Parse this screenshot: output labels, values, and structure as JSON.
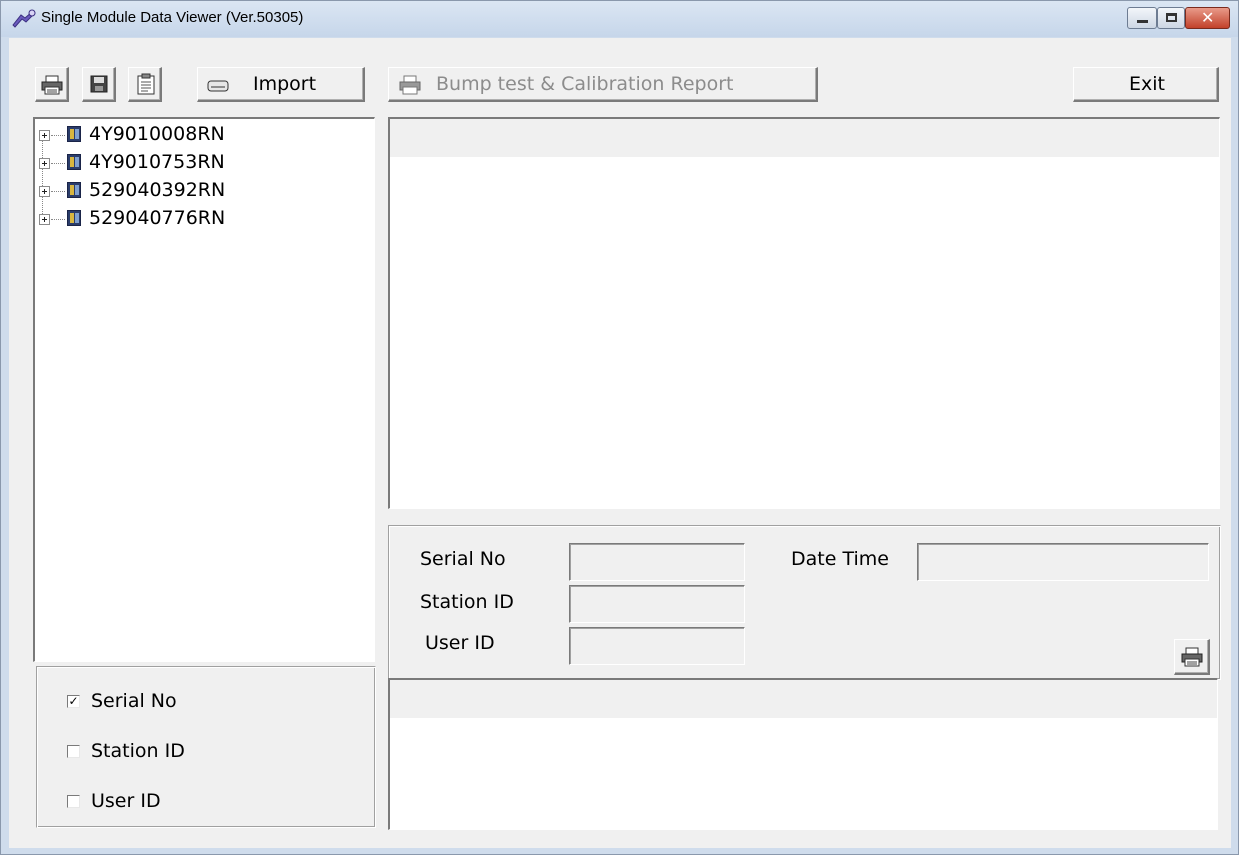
{
  "window": {
    "title": "Single Module Data Viewer (Ver.50305)",
    "close_glyph": "✕"
  },
  "toolbar": {
    "import_label": "Import",
    "bump_report_label": "Bump test & Calibration Report",
    "exit_label": "Exit"
  },
  "tree": {
    "items": [
      {
        "label": "4Y9010008RN"
      },
      {
        "label": "4Y9010753RN"
      },
      {
        "label": "529040392RN"
      },
      {
        "label": "529040776RN"
      }
    ]
  },
  "filters": {
    "items": [
      {
        "label": "Serial No",
        "checked": true,
        "mark": "✓"
      },
      {
        "label": "Station ID",
        "checked": false,
        "mark": ""
      },
      {
        "label": "User ID",
        "checked": false,
        "mark": ""
      }
    ]
  },
  "details": {
    "serial_no_label": "Serial No",
    "serial_no_value": "",
    "station_id_label": "Station ID",
    "station_id_value": "",
    "user_id_label": "User ID",
    "user_id_value": "",
    "date_time_label": "Date Time",
    "date_time_value": ""
  }
}
